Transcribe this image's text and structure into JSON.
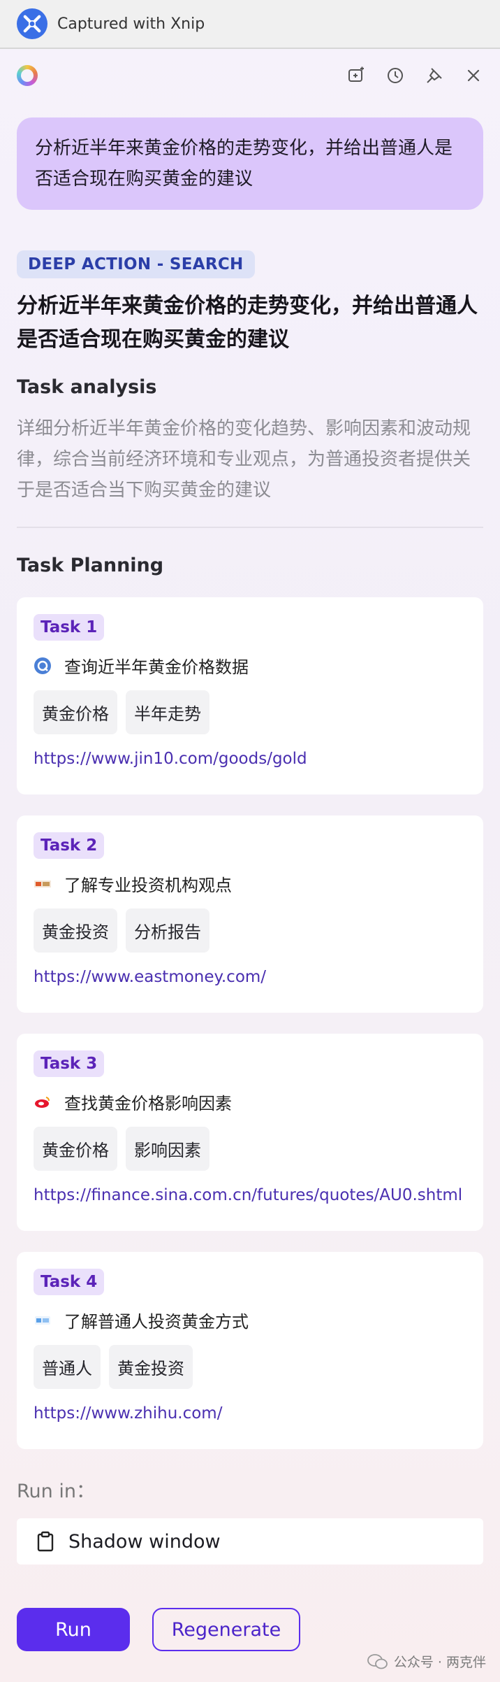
{
  "titlebar": {
    "app_title": "Captured with Xnip",
    "icon": "xnip-icon"
  },
  "toolbar": {
    "logo": "app-logo",
    "icons": [
      "new-chat-icon",
      "history-icon",
      "pin-icon",
      "close-icon"
    ]
  },
  "user_message": "分析近半年来黄金价格的走势变化，并给出普通人是否适合现在购买黄金的建议",
  "mode_badge": "DEEP ACTION - SEARCH",
  "task_title": "分析近半年来黄金价格的走势变化，并给出普通人是否适合现在购买黄金的建议",
  "analysis": {
    "label": "Task analysis",
    "text": "详细分析近半年黄金价格的变化趋势、影响因素和波动规律，综合当前经济环境和专业观点，为普通投资者提供关于是否适合当下购买黄金的建议"
  },
  "planning": {
    "label": "Task Planning",
    "tasks": [
      {
        "tag": "Task 1",
        "name": "查询近半年黄金价格数据",
        "icon": "jin10-icon",
        "chips": [
          "黄金价格",
          "半年走势"
        ],
        "url": "https://www.jin10.com/goods/gold"
      },
      {
        "tag": "Task 2",
        "name": "了解专业投资机构观点",
        "icon": "eastmoney-icon",
        "chips": [
          "黄金投资",
          "分析报告"
        ],
        "url": "https://www.eastmoney.com/"
      },
      {
        "tag": "Task 3",
        "name": "查找黄金价格影响因素",
        "icon": "sina-icon",
        "chips": [
          "黄金价格",
          "影响因素"
        ],
        "url": "https://finance.sina.com.cn/futures/quotes/AU0.shtml"
      },
      {
        "tag": "Task 4",
        "name": "了解普通人投资黄金方式",
        "icon": "zhihu-icon",
        "chips": [
          "普通人",
          "黄金投资"
        ],
        "url": "https://www.zhihu.com/"
      }
    ]
  },
  "run_in": {
    "label": "Run in：",
    "value": "Shadow window",
    "icon": "clipboard-icon"
  },
  "buttons": {
    "run": "Run",
    "regenerate": "Regenerate"
  },
  "watermark": {
    "text": "公众号 · 两克伴",
    "icon": "wechat-icon"
  },
  "colors": {
    "accent": "#5b2ded",
    "bubble": "#dbc6fb",
    "badge_bg": "#dde2f7",
    "link": "#4a2fb0"
  }
}
